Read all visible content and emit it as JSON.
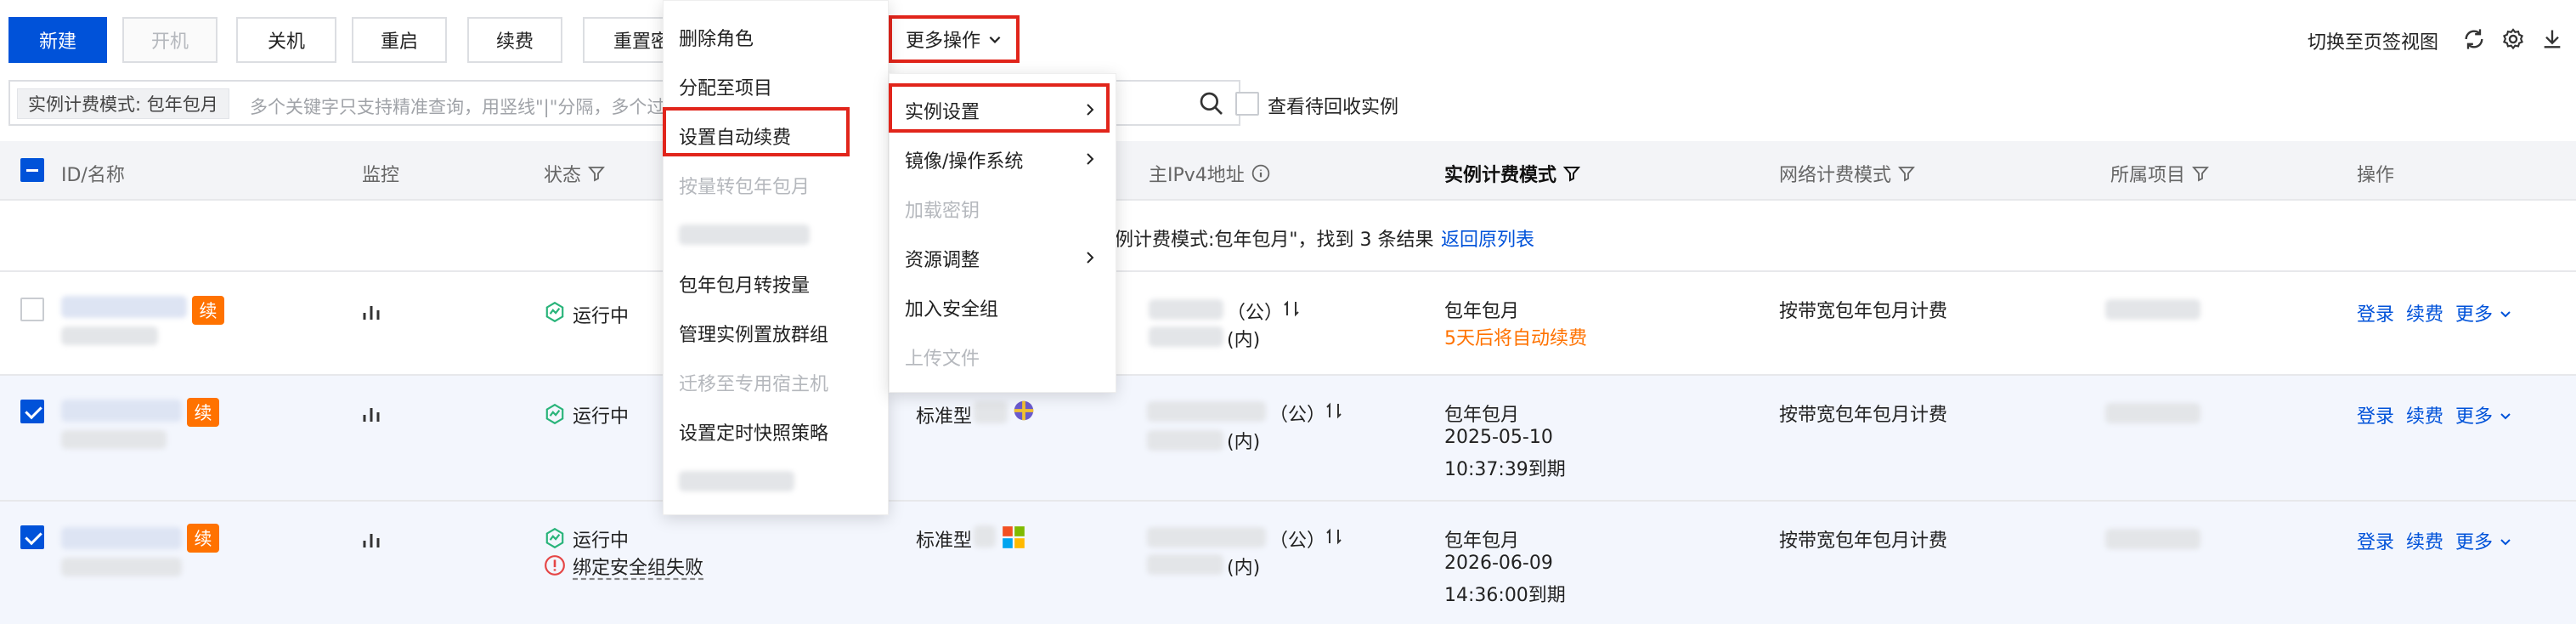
{
  "toolbar": {
    "new": "新建",
    "start": "开机",
    "shutdown": "关机",
    "restart": "重启",
    "renew": "续费",
    "reset_pwd": "重置密",
    "more_ops": "更多操作",
    "switch_view": "切换至页签视图"
  },
  "search": {
    "tag": "实例计费模式: 包年包月",
    "placeholder": "多个关键字只支持精准查询，用竖线\"|\"分隔，多个过",
    "recycle_label": "查看待回收实例"
  },
  "columns": {
    "id": "ID/名称",
    "monitor": "监控",
    "status": "状态",
    "ipv4": "主IPv4地址",
    "billing": "实例计费模式",
    "net_billing": "网络计费模式",
    "project": "所属项目",
    "ops": "操作"
  },
  "info_bar": {
    "text": "例计费模式:包年包月\"，找到 3 条结果",
    "back_link": "返回原列表"
  },
  "rows": [
    {
      "badge": "续",
      "status": "运行中",
      "spec": "",
      "ip_public": "（公）",
      "ip_private": "(内)",
      "billing_line1": "包年包月",
      "billing_line2": "5天后将自动续费",
      "billing_line3": "",
      "net_billing": "按带宽包年包月计费",
      "op_login": "登录",
      "op_renew": "续费",
      "op_more": "更多"
    },
    {
      "badge": "续",
      "status": "运行中",
      "spec": "标准型",
      "ip_public": "（公）",
      "ip_private": "(内)",
      "billing_line1": "包年包月",
      "billing_line2": "2025-05-10",
      "billing_line3": "10:37:39到期",
      "net_billing": "按带宽包年包月计费",
      "op_login": "登录",
      "op_renew": "续费",
      "op_more": "更多"
    },
    {
      "badge": "续",
      "status": "运行中",
      "status_error": "绑定安全组失败",
      "spec": "标准型",
      "ip_public": "（公）",
      "ip_private": "(内)",
      "billing_line1": "包年包月",
      "billing_line2": "2026-06-09",
      "billing_line3": "14:36:00到期",
      "net_billing": "按带宽包年包月计费",
      "op_login": "登录",
      "op_renew": "续费",
      "op_more": "更多"
    }
  ],
  "submenu_left": {
    "items": [
      {
        "label": "删除角色",
        "disabled": false
      },
      {
        "label": "分配至项目",
        "disabled": false
      },
      {
        "label": "设置自动续费",
        "disabled": false
      },
      {
        "label": "按量转包年包月",
        "disabled": true
      },
      {
        "label": "包年包月转按量",
        "disabled": false
      },
      {
        "label": "管理实例置放群组",
        "disabled": false
      },
      {
        "label": "迁移至专用宿主机",
        "disabled": true
      },
      {
        "label": "设置定时快照策略",
        "disabled": false
      }
    ]
  },
  "more_menu": {
    "items": [
      {
        "label": "实例设置",
        "disabled": false
      },
      {
        "label": "镜像/操作系统",
        "disabled": false
      },
      {
        "label": "加载密钥",
        "disabled": true
      },
      {
        "label": "资源调整",
        "disabled": false
      },
      {
        "label": "加入安全组",
        "disabled": false
      },
      {
        "label": "上传文件",
        "disabled": true
      }
    ]
  },
  "colors": {
    "primary": "#0052d9",
    "highlight": "#e1251b",
    "badge": "#ff7200",
    "running": "#29b47a",
    "error": "#e54545"
  }
}
